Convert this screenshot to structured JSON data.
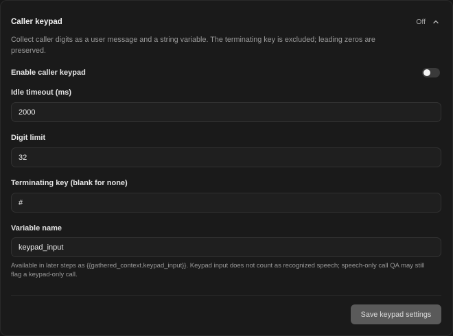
{
  "section": {
    "title": "Caller keypad",
    "status": "Off",
    "description": "Collect caller digits as a user message and a string variable. The terminating key is excluded; leading zeros are preserved."
  },
  "enable": {
    "label": "Enable caller keypad",
    "enabled": false
  },
  "fields": {
    "idle_timeout": {
      "label": "Idle timeout (ms)",
      "value": "2000"
    },
    "digit_limit": {
      "label": "Digit limit",
      "value": "32"
    },
    "terminating_key": {
      "label": "Terminating key (blank for none)",
      "value": "#"
    },
    "variable_name": {
      "label": "Variable name",
      "value": "keypad_input"
    }
  },
  "help_text": "Available in later steps as {{gathered_context.keypad_input}}. Keypad input does not count as recognized speech; speech-only call QA may still flag a keypad-only call.",
  "actions": {
    "save_label": "Save keypad settings"
  },
  "icons": {
    "collapse": "chevron-up-icon"
  }
}
